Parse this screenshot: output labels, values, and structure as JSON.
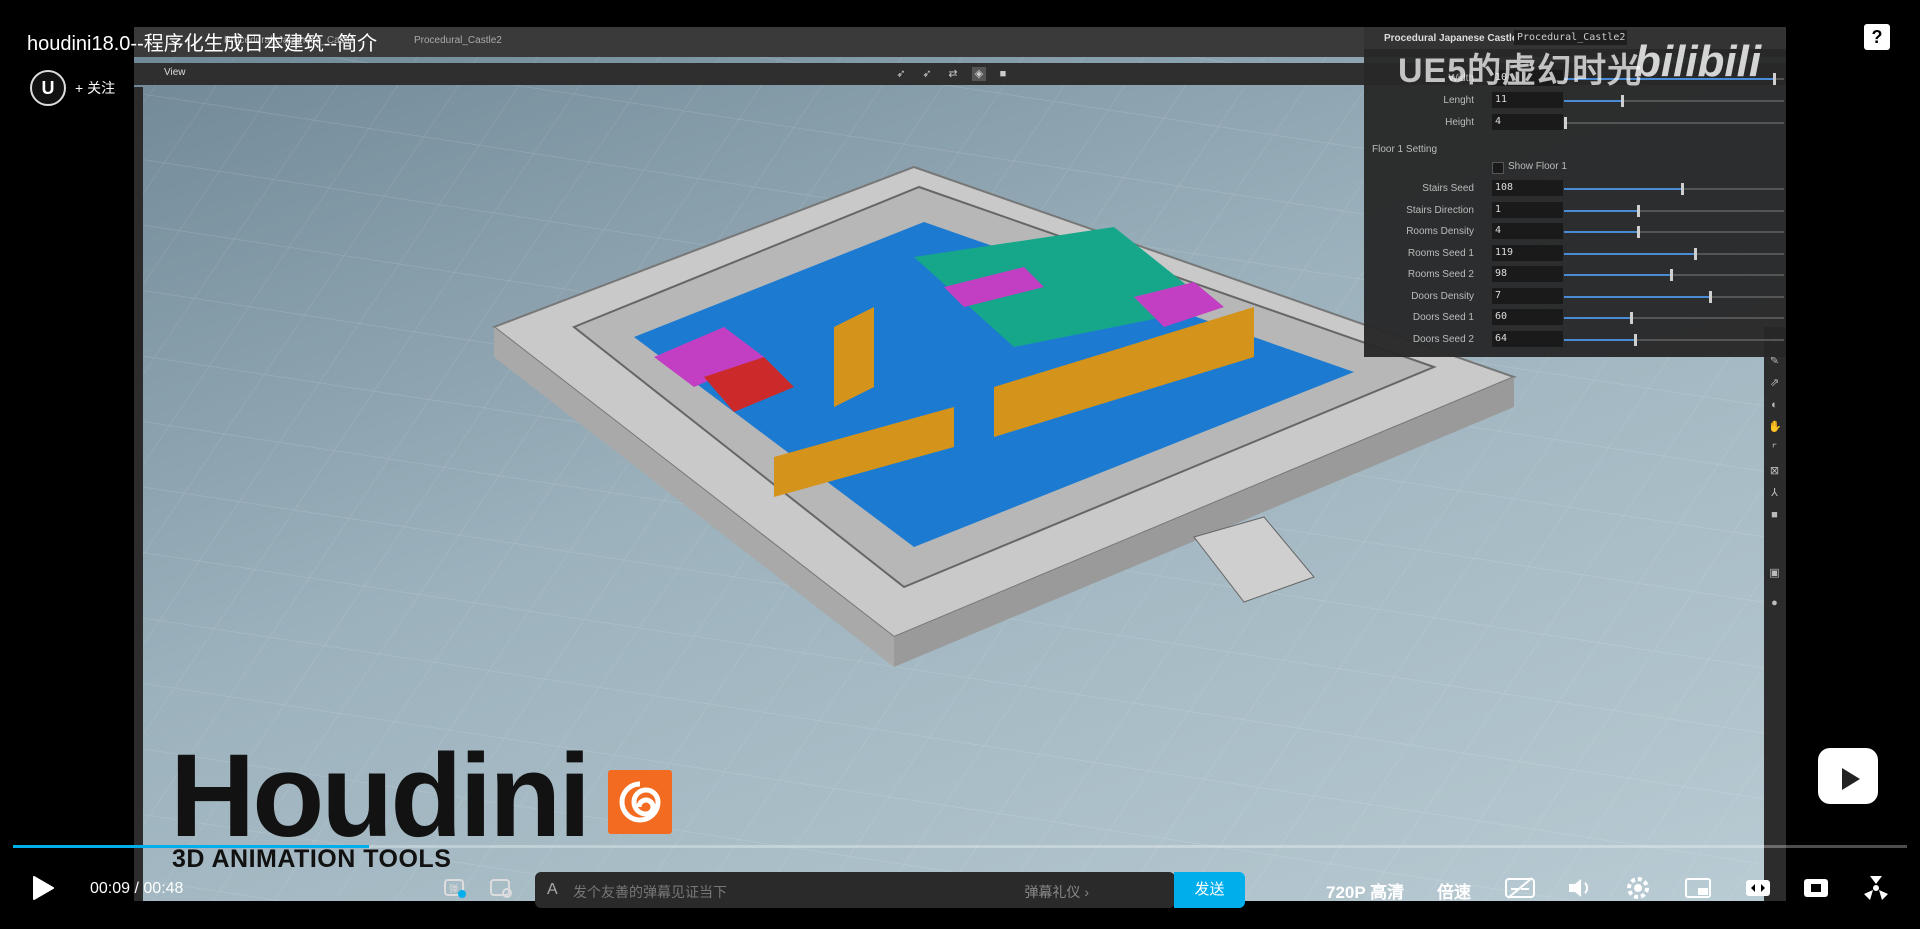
{
  "video": {
    "title": "houdini18.0--程序化生成日本建筑--简介",
    "follow_label": "+ 关注",
    "watermark": "UE5的虚幻时光",
    "bili_logo": "bilibili",
    "help_glyph": "?",
    "avatar_glyph": "U"
  },
  "houdini": {
    "tab1": "Procedural_Japanese_Castle",
    "tab2": "Procedural_Castle2",
    "view_label": "View",
    "panel_title": "Procedural Japanese Castle",
    "panel_node": "Procedural_Castle2",
    "castle_params": [
      {
        "label": "Width",
        "value": "10",
        "level": 0.95
      },
      {
        "label": "Lenght",
        "value": "11",
        "level": 0.26
      },
      {
        "label": "Height",
        "value": "4",
        "level": 0.0
      }
    ],
    "floor_section": "Floor 1 Setting",
    "show_floor_label": "Show Floor 1",
    "floor_params": [
      {
        "label": "Stairs Seed",
        "value": "108",
        "level": 0.53
      },
      {
        "label": "Stairs Direction",
        "value": "1",
        "level": 0.33
      },
      {
        "label": "Rooms Density",
        "value": "4",
        "level": 0.33
      },
      {
        "label": "Rooms Seed 1",
        "value": "119",
        "level": 0.59
      },
      {
        "label": "Rooms Seed 2",
        "value": "98",
        "level": 0.48
      },
      {
        "label": "Doors Density",
        "value": "7",
        "level": 0.66
      },
      {
        "label": "Doors Seed 1",
        "value": "60",
        "level": 0.3
      },
      {
        "label": "Doors Seed 2",
        "value": "64",
        "level": 0.32
      }
    ],
    "logo_text": "Houdini",
    "logo_sub": "3D ANIMATION TOOLS"
  },
  "player": {
    "current_time": "00:09",
    "separator": "/",
    "duration": "00:48",
    "progress": 0.188,
    "danmaku_placeholder": "发个友善的弹幕见证当下",
    "danmaku_etiquette": "弹幕礼仪 ›",
    "send_label": "发送",
    "quality_label": "720P 高清",
    "speed_label": "倍速"
  },
  "colors": {
    "accent": "#00aeec",
    "houdini_orange": "#f26b21"
  },
  "icons": [
    "play-icon",
    "danmaku-toggle-icon",
    "danmaku-settings-icon",
    "subtitle-icon",
    "volume-icon",
    "settings-icon",
    "picture-in-picture-icon",
    "widescreen-icon",
    "web-fullscreen-icon",
    "fullscreen-icon",
    "help-icon",
    "float-play-icon"
  ]
}
